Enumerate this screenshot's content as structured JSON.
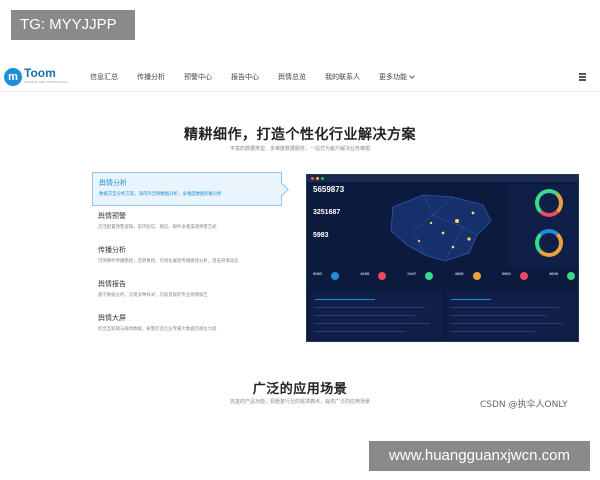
{
  "watermark": {
    "tg": "TG: MYYJJPP",
    "csdn": "CSDN @执伞人ONLY",
    "site": "www.huangguanxjwcn.com"
  },
  "brand": {
    "name": "Toom",
    "mark": "m",
    "sub": "SCIENCE AND TECHNOLOGY"
  },
  "nav": {
    "items": [
      "信息汇总",
      "传播分析",
      "预警中心",
      "报告中心",
      "舆情总览",
      "我的联系人"
    ],
    "more": "更多功能"
  },
  "hero": {
    "title": "精耕细作，打造个性化行业解决方案",
    "subtitle": "丰富的数据类型、多维度数据服务，一站式为客户解决业务难题"
  },
  "features": [
    {
      "title": "舆情分析",
      "desc": "数据交互分析方案，海内外全网数据分析，多维度数据挖掘分析"
    },
    {
      "title": "舆情预警",
      "desc": "灵活配置预警逻辑，支持短信、微信、邮件多重渠道预警方式"
    },
    {
      "title": "传播分析",
      "desc": "可溯事件传播路径，还原真相，可视化展现传播路径分析，直击舆情动态"
    },
    {
      "title": "舆情报告",
      "desc": "基于数据分析，呈现多种样式，内容直观的专业舆情报告"
    },
    {
      "title": "舆情大屏",
      "desc": "结合互联网与媒体数据，按需打造企业专属大数据可视化大屏"
    }
  ],
  "dashboard": {
    "stats": [
      "5659873",
      "3251687",
      "5983"
    ],
    "kpis": [
      "5983",
      "4698",
      "9447",
      "4698",
      "5983",
      "4698"
    ],
    "colors": {
      "bg": "#0c1a3d",
      "panel": "#101f48",
      "accent": "#1c8fd8"
    }
  },
  "section": {
    "title": "广泛的应用场景",
    "subtitle": "完善的产品功能，洞悉各行业的需求痛点，提供广泛的应用场景"
  }
}
